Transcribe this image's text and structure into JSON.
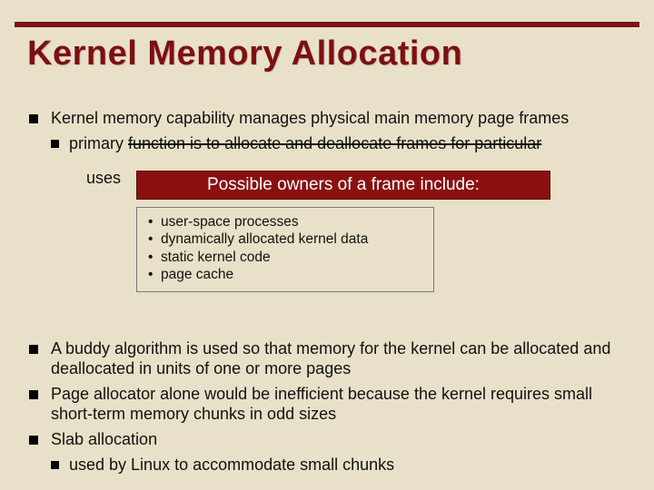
{
  "title": "Kernel Memory Allocation",
  "bullet1": "Kernel memory capability manages physical main memory page frames",
  "bullet1_sub_pre": "primary ",
  "bullet1_sub_strike": "function is to allocate and deallocate frames for particular",
  "bullet1_sub_tail": "uses",
  "callout": "Possible owners of a frame include:",
  "owners": {
    "a": "user-space processes",
    "b": "dynamically allocated kernel data",
    "c": "static kernel code",
    "d": "page cache"
  },
  "bullet2": "A buddy algorithm is used so that memory for the kernel can be allocated and deallocated in units of one or more pages",
  "bullet3": "Page allocator alone would be inefficient because the kernel requires small short-term memory chunks in odd sizes",
  "bullet4": "Slab allocation",
  "bullet4_sub": "used by Linux to accommodate small chunks"
}
